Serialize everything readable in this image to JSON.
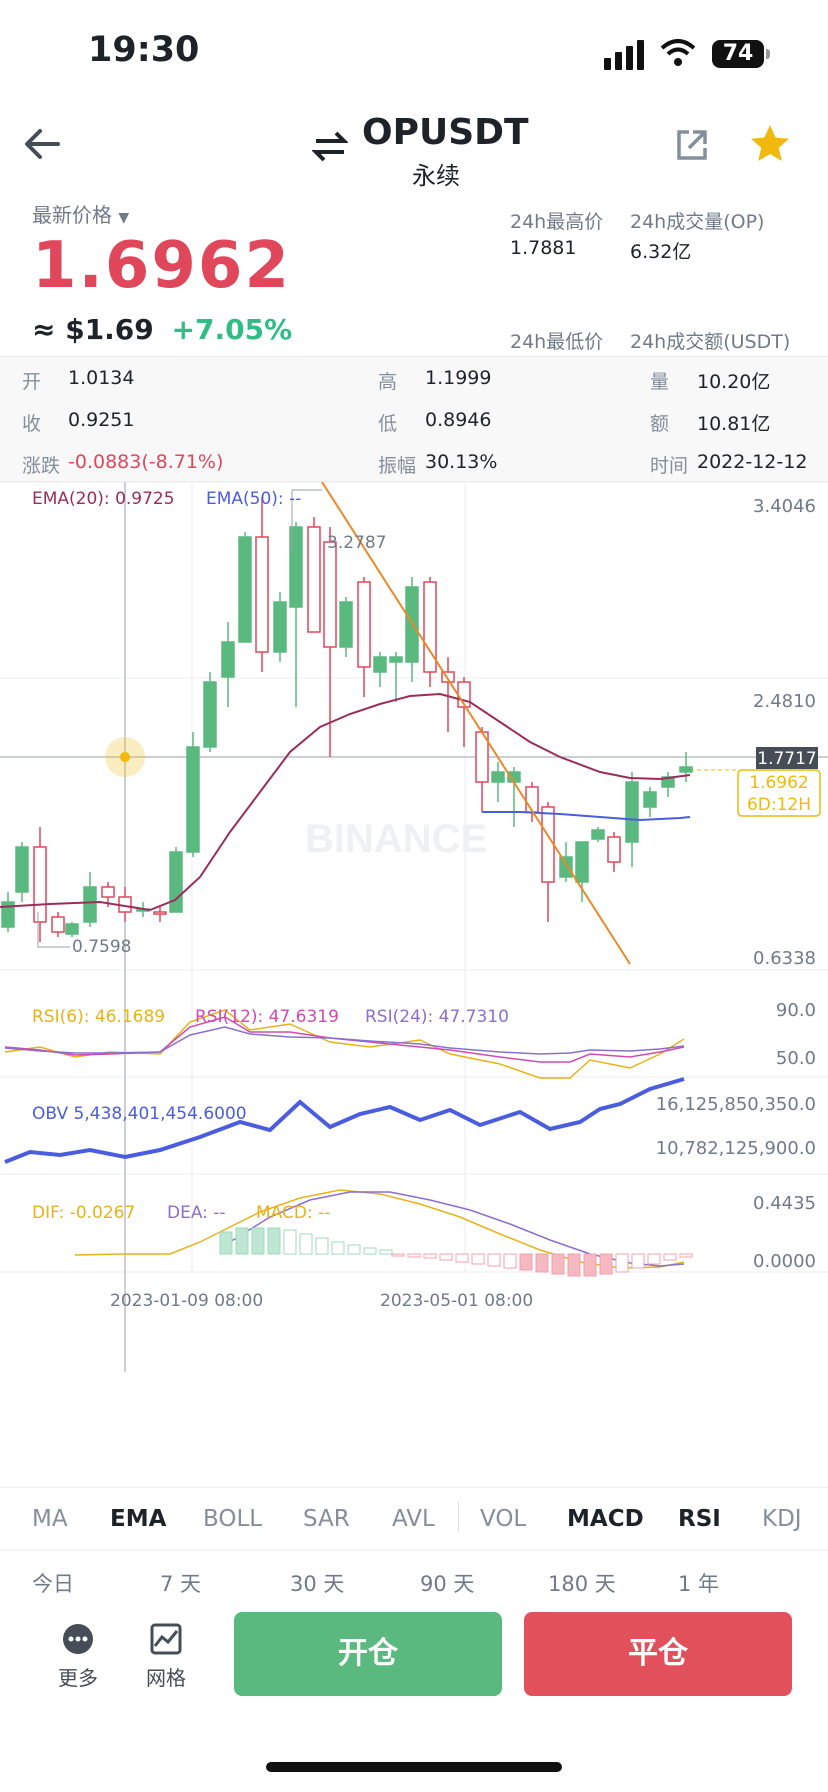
{
  "status": {
    "time": "19:30",
    "battery": "74"
  },
  "header": {
    "title": "OPUSDT",
    "subtitle": "永续"
  },
  "price": {
    "latest_label": "最新价格",
    "value": "1.6962",
    "usd": "≈ $1.69",
    "change_pct": "+7.05%",
    "high_label": "24h最高价",
    "high": "1.7881",
    "vol_label": "24h成交量(OP)",
    "vol": "6.32亿",
    "low_label": "24h最低价",
    "amount_label": "24h成交额(USDT)"
  },
  "ohlc": {
    "open_label": "开",
    "open": "1.0134",
    "high_label": "高",
    "high": "1.1999",
    "qty_label": "量",
    "qty": "10.20亿",
    "close_label": "收",
    "close": "0.9251",
    "low_label": "低",
    "low": "0.8946",
    "amt_label": "额",
    "amt": "10.81亿",
    "chg_label": "涨跌",
    "chg": "-0.0883(-8.71%)",
    "amp_label": "振幅",
    "amp": "30.13%",
    "time_label": "时间",
    "time": "2022-12-12"
  },
  "chart": {
    "ema20": "EMA(20): 0.9725",
    "ema50": "EMA(50): --",
    "y_top": "3.4046",
    "y_mid": "2.4810",
    "y_low": "0.6338",
    "hi_mark": "3.2787",
    "lo_mark": "0.7598",
    "cross_price": "1.7717",
    "last_price": "1.6962",
    "countdown": "6D:12H",
    "watermark": "BINANCE",
    "rsi6": "RSI(6): 46.1689",
    "rsi12": "RSI(12): 47.6319",
    "rsi24": "RSI(24): 47.7310",
    "rsi_90": "90.0",
    "rsi_50": "50.0",
    "obv": "OBV 5,438,401,454.6000",
    "obv_hi": "16,125,850,350.0",
    "obv_mid": "10,782,125,900.0",
    "dif": "DIF: -0.0267",
    "dea": "DEA: --",
    "macd": "MACD: --",
    "macd_hi": "0.4435",
    "macd_zero": "0.0000",
    "x1": "2023-01-09 08:00",
    "x2": "2023-05-01 08:00",
    "colors": {
      "up": "#5ab97f",
      "down": "#e0475b",
      "ema20": "#9b2d5a",
      "ema50": "#4a5ce0"
    }
  },
  "indicator_tabs": [
    "MA",
    "EMA",
    "BOLL",
    "SAR",
    "AVL",
    "VOL",
    "MACD",
    "RSI",
    "KDJ"
  ],
  "period_tabs": [
    "今日",
    "7 天",
    "30 天",
    "90 天",
    "180 天",
    "1 年"
  ],
  "bottom": {
    "more": "更多",
    "grid": "网格",
    "open": "开仓",
    "close": "平仓"
  }
}
